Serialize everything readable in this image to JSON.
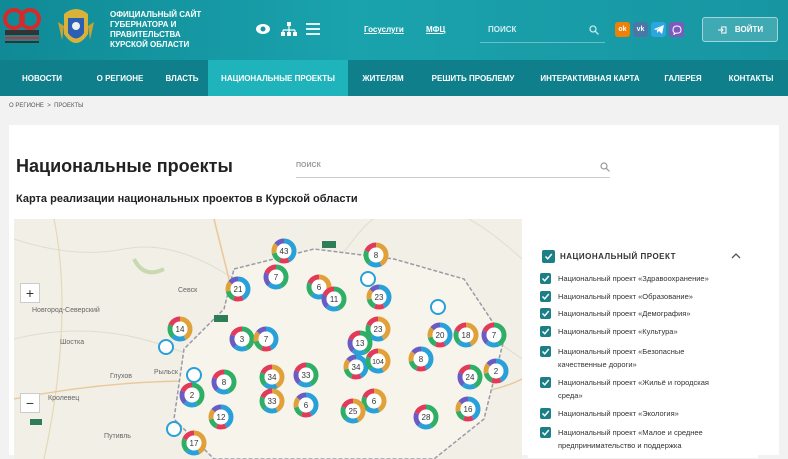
{
  "header": {
    "anniversary_number": "80",
    "site_title": "Официальный сайт Губернатора и Правительства Курской области",
    "links": [
      "Госуслуги",
      "МФЦ"
    ],
    "search_placeholder": "ПОИСК",
    "social": [
      "ok",
      "vk",
      "tg",
      "viber"
    ],
    "login_label": "ВОЙТИ"
  },
  "nav": [
    "НОВОСТИ",
    "О РЕГИОНЕ",
    "ВЛАСТЬ",
    "НАЦИОНАЛЬНЫЕ ПРОЕКТЫ",
    "ЖИТЕЛЯМ",
    "РЕШИТЬ ПРОБЛЕМУ",
    "ИНТЕРАКТИВНАЯ КАРТА",
    "ГАЛЕРЕЯ",
    "КОНТАКТЫ"
  ],
  "nav_active": 3,
  "breadcrumb": [
    "О РЕГИОНЕ",
    ">",
    "ПРОЕКТЫ"
  ],
  "page": {
    "title": "Национальные проекты",
    "search_placeholder": "ПОИСК",
    "map_title": "Карта реализации национальных проектов в Курской области"
  },
  "map": {
    "places": [
      "Новгород-Северский",
      "Шостка",
      "Глухов",
      "Кролевец",
      "Путивль",
      "Севск",
      "Рыльск"
    ],
    "clusters": [
      "43",
      "8",
      "7",
      "21",
      "6",
      "11",
      "23",
      "14",
      "3",
      "7",
      "23",
      "13",
      "20",
      "18",
      "7",
      "8",
      "34",
      "33",
      "34",
      "104",
      "8",
      "2",
      "33",
      "2",
      "6",
      "6",
      "24",
      "12",
      "25",
      "28",
      "16",
      "17"
    ]
  },
  "panel": {
    "header": "НАЦИОНАЛЬНЫЙ ПРОЕКТ",
    "items": [
      "Национальный проект «Здравоохранение»",
      "Национальный проект «Образование»",
      "Национальный проект «Демография»",
      "Национальный проект «Культура»",
      "Национальный проект «Безопасные качественные дороги»",
      "Национальный проект «Жильё и городская среда»",
      "Национальный проект «Экология»",
      "Национальный проект «Малое и среднее предпринимательство и поддержка"
    ]
  },
  "colors": {
    "teal": "#1596a1",
    "nav": "#0e7f8b",
    "active": "#1fb3bb",
    "check": "#1a7f86"
  }
}
